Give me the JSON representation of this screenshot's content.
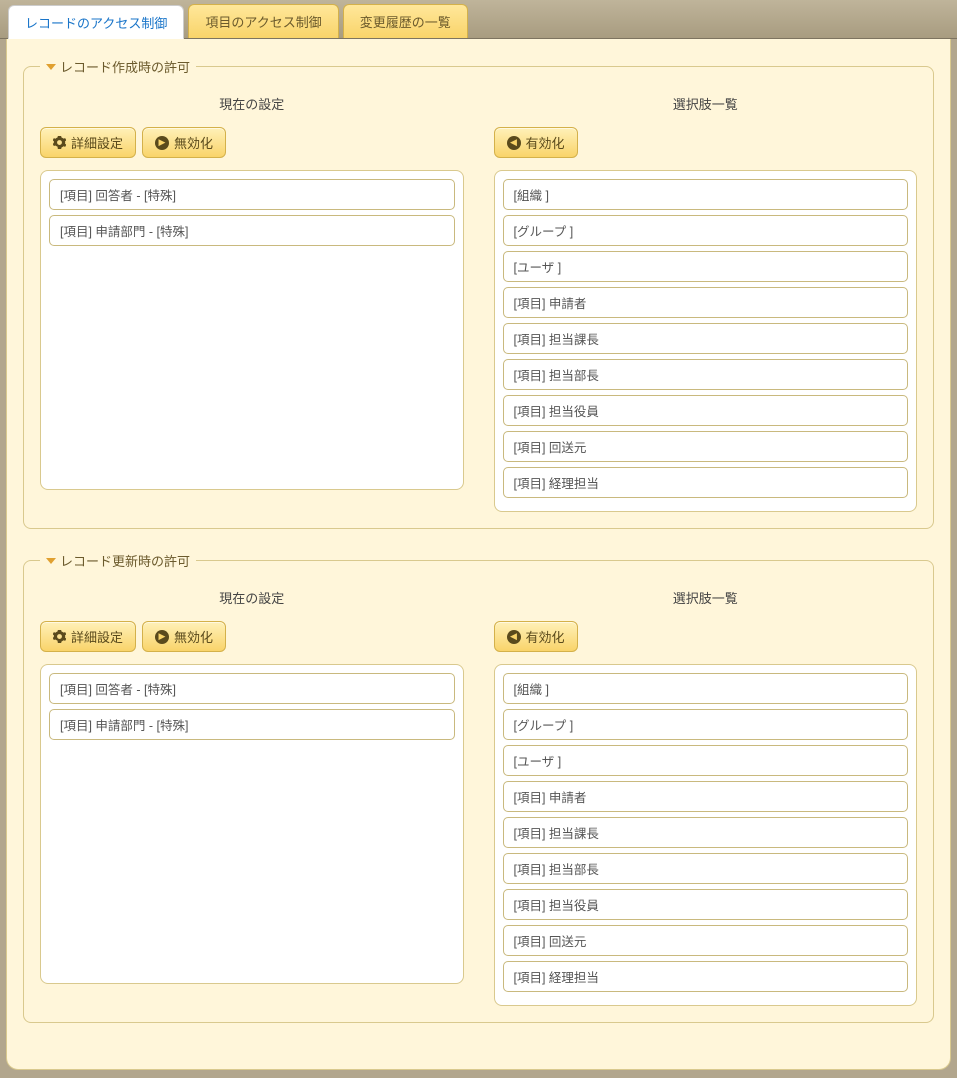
{
  "tabs": [
    {
      "label": "レコードのアクセス制御",
      "active": true
    },
    {
      "label": "項目のアクセス制御",
      "active": false
    },
    {
      "label": "変更履歴の一覧",
      "active": false
    }
  ],
  "buttons": {
    "detail": "詳細設定",
    "disable": "無効化",
    "enable": "有効化"
  },
  "headers": {
    "current": "現在の設定",
    "options": "選択肢一覧"
  },
  "sections": [
    {
      "legend": "レコード作成時の許可",
      "current": [
        "[項目] 回答者 - [特殊]",
        "[項目] 申請部門 - [特殊]"
      ],
      "options": [
        "[組織 ]",
        "[グループ ]",
        "[ユーザ ]",
        "[項目] 申請者",
        "[項目] 担当課長",
        "[項目] 担当部長",
        "[項目] 担当役員",
        "[項目] 回送元",
        "[項目] 経理担当"
      ]
    },
    {
      "legend": "レコード更新時の許可",
      "current": [
        "[項目] 回答者 - [特殊]",
        "[項目] 申請部門 - [特殊]"
      ],
      "options": [
        "[組織 ]",
        "[グループ ]",
        "[ユーザ ]",
        "[項目] 申請者",
        "[項目] 担当課長",
        "[項目] 担当部長",
        "[項目] 担当役員",
        "[項目] 回送元",
        "[項目] 経理担当"
      ]
    }
  ]
}
